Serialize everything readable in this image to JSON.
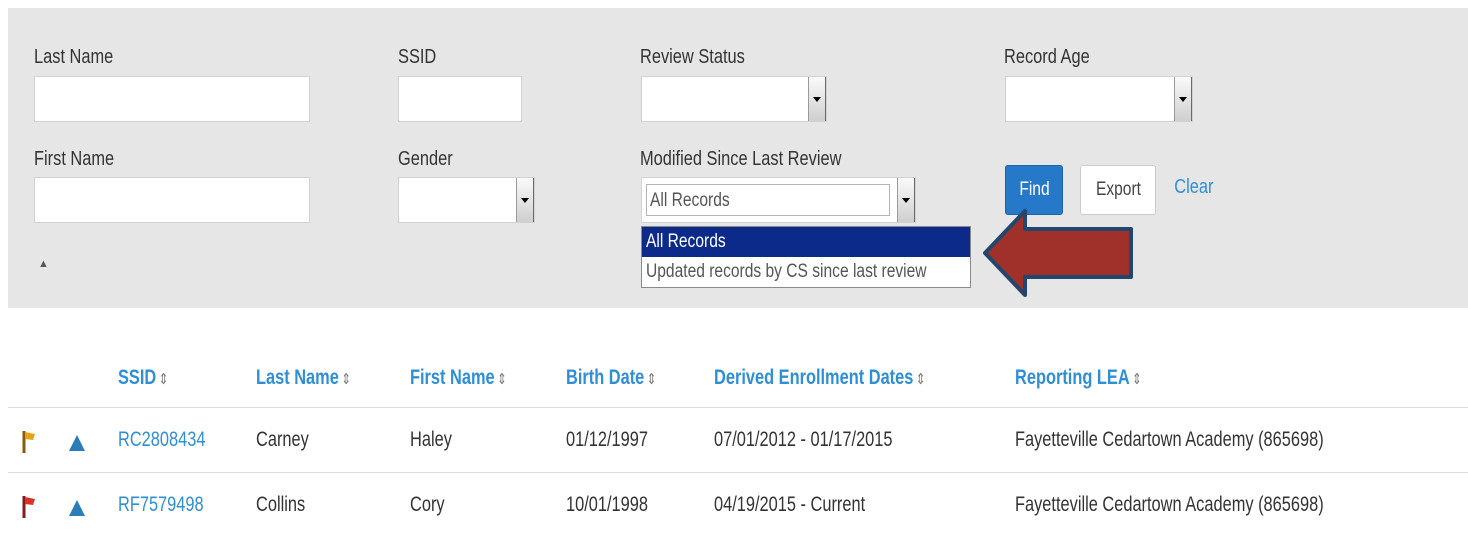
{
  "filters": {
    "last_name": {
      "label": "Last Name",
      "value": ""
    },
    "ssid": {
      "label": "SSID",
      "value": ""
    },
    "review_status": {
      "label": "Review Status",
      "value": ""
    },
    "record_age": {
      "label": "Record Age",
      "value": ""
    },
    "first_name": {
      "label": "First Name",
      "value": ""
    },
    "gender": {
      "label": "Gender",
      "value": ""
    },
    "modified_since": {
      "label": "Modified Since Last Review",
      "value": "All Records",
      "options": [
        "All Records",
        "Updated records by CS since last review"
      ]
    }
  },
  "buttons": {
    "find": "Find",
    "export": "Export",
    "clear": "Clear"
  },
  "collapse_caret": "▲",
  "colors": {
    "accent": "#2f8fd6",
    "find_button": "#2678c8",
    "selected_option": "#0b2a8a",
    "pointer_arrow": "#a0302a",
    "flag_orange": "#e8a21a",
    "flag_red": "#d8322a"
  },
  "table": {
    "columns": [
      "SSID",
      "Last Name",
      "First Name",
      "Birth Date",
      "Derived Enrollment Dates",
      "Reporting LEA"
    ],
    "sort_icon": "⇕",
    "rows": [
      {
        "flag_color": "orange",
        "ssid": "RC2808434",
        "last_name": "Carney",
        "first_name": "Haley",
        "birth_date": "01/12/1997",
        "enrollment": "07/01/2012 - 01/17/2015",
        "lea": "Fayetteville Cedartown Academy (865698)"
      },
      {
        "flag_color": "red",
        "ssid": "RF7579498",
        "last_name": "Collins",
        "first_name": "Cory",
        "birth_date": "10/01/1998",
        "enrollment": "04/19/2015 - Current",
        "lea": "Fayetteville Cedartown Academy (865698)"
      }
    ]
  }
}
